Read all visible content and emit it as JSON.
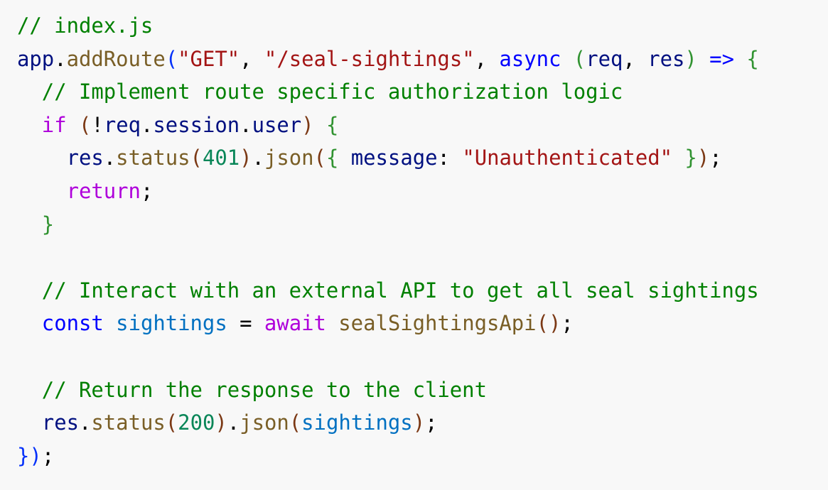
{
  "code": {
    "lines": [
      [
        {
          "text": "// index.js",
          "type": "comment"
        }
      ],
      [
        {
          "text": "app",
          "type": "variable"
        },
        {
          "text": ".",
          "type": "punct"
        },
        {
          "text": "addRoute",
          "type": "function"
        },
        {
          "text": "(",
          "type": "bracket1"
        },
        {
          "text": "\"GET\"",
          "type": "string"
        },
        {
          "text": ", ",
          "type": "punct"
        },
        {
          "text": "\"/seal-sightings\"",
          "type": "string"
        },
        {
          "text": ", ",
          "type": "punct"
        },
        {
          "text": "async",
          "type": "keyword"
        },
        {
          "text": " ",
          "type": "punct"
        },
        {
          "text": "(",
          "type": "bracket2"
        },
        {
          "text": "req",
          "type": "variable"
        },
        {
          "text": ", ",
          "type": "punct"
        },
        {
          "text": "res",
          "type": "variable"
        },
        {
          "text": ")",
          "type": "bracket2"
        },
        {
          "text": " => ",
          "type": "keyword"
        },
        {
          "text": "{",
          "type": "bracket2"
        }
      ],
      [
        {
          "text": "  ",
          "type": "punct"
        },
        {
          "text": "// Implement route specific authorization logic",
          "type": "comment"
        }
      ],
      [
        {
          "text": "  ",
          "type": "punct"
        },
        {
          "text": "if",
          "type": "control"
        },
        {
          "text": " ",
          "type": "punct"
        },
        {
          "text": "(",
          "type": "bracket3"
        },
        {
          "text": "!",
          "type": "punct"
        },
        {
          "text": "req",
          "type": "variable"
        },
        {
          "text": ".",
          "type": "punct"
        },
        {
          "text": "session",
          "type": "variable"
        },
        {
          "text": ".",
          "type": "punct"
        },
        {
          "text": "user",
          "type": "variable"
        },
        {
          "text": ")",
          "type": "bracket3"
        },
        {
          "text": " ",
          "type": "punct"
        },
        {
          "text": "{",
          "type": "bracket2"
        }
      ],
      [
        {
          "text": "    ",
          "type": "punct"
        },
        {
          "text": "res",
          "type": "variable"
        },
        {
          "text": ".",
          "type": "punct"
        },
        {
          "text": "status",
          "type": "function"
        },
        {
          "text": "(",
          "type": "bracket3"
        },
        {
          "text": "401",
          "type": "number"
        },
        {
          "text": ")",
          "type": "bracket3"
        },
        {
          "text": ".",
          "type": "punct"
        },
        {
          "text": "json",
          "type": "function"
        },
        {
          "text": "(",
          "type": "bracket3"
        },
        {
          "text": "{",
          "type": "bracket2"
        },
        {
          "text": " ",
          "type": "punct"
        },
        {
          "text": "message",
          "type": "variable"
        },
        {
          "text": ": ",
          "type": "punct"
        },
        {
          "text": "\"Unauthenticated\"",
          "type": "string"
        },
        {
          "text": " ",
          "type": "punct"
        },
        {
          "text": "}",
          "type": "bracket2"
        },
        {
          "text": ")",
          "type": "bracket3"
        },
        {
          "text": ";",
          "type": "punct"
        }
      ],
      [
        {
          "text": "    ",
          "type": "punct"
        },
        {
          "text": "return",
          "type": "control"
        },
        {
          "text": ";",
          "type": "punct"
        }
      ],
      [
        {
          "text": "  ",
          "type": "punct"
        },
        {
          "text": "}",
          "type": "bracket2"
        }
      ],
      [],
      [
        {
          "text": "  ",
          "type": "punct"
        },
        {
          "text": "// Interact with an external API to get all seal sightings",
          "type": "comment"
        }
      ],
      [
        {
          "text": "  ",
          "type": "punct"
        },
        {
          "text": "const",
          "type": "keyword"
        },
        {
          "text": " ",
          "type": "punct"
        },
        {
          "text": "sightings",
          "type": "const"
        },
        {
          "text": " = ",
          "type": "punct"
        },
        {
          "text": "await",
          "type": "control"
        },
        {
          "text": " ",
          "type": "punct"
        },
        {
          "text": "sealSightingsApi",
          "type": "function"
        },
        {
          "text": "(",
          "type": "bracket3"
        },
        {
          "text": ")",
          "type": "bracket3"
        },
        {
          "text": ";",
          "type": "punct"
        }
      ],
      [],
      [
        {
          "text": "  ",
          "type": "punct"
        },
        {
          "text": "// Return the response to the client",
          "type": "comment"
        }
      ],
      [
        {
          "text": "  ",
          "type": "punct"
        },
        {
          "text": "res",
          "type": "variable"
        },
        {
          "text": ".",
          "type": "punct"
        },
        {
          "text": "status",
          "type": "function"
        },
        {
          "text": "(",
          "type": "bracket3"
        },
        {
          "text": "200",
          "type": "number"
        },
        {
          "text": ")",
          "type": "bracket3"
        },
        {
          "text": ".",
          "type": "punct"
        },
        {
          "text": "json",
          "type": "function"
        },
        {
          "text": "(",
          "type": "bracket3"
        },
        {
          "text": "sightings",
          "type": "const"
        },
        {
          "text": ")",
          "type": "bracket3"
        },
        {
          "text": ";",
          "type": "punct"
        }
      ],
      [
        {
          "text": "}",
          "type": "bracket1"
        },
        {
          "text": ")",
          "type": "bracket1"
        },
        {
          "text": ";",
          "type": "punct"
        }
      ]
    ]
  }
}
